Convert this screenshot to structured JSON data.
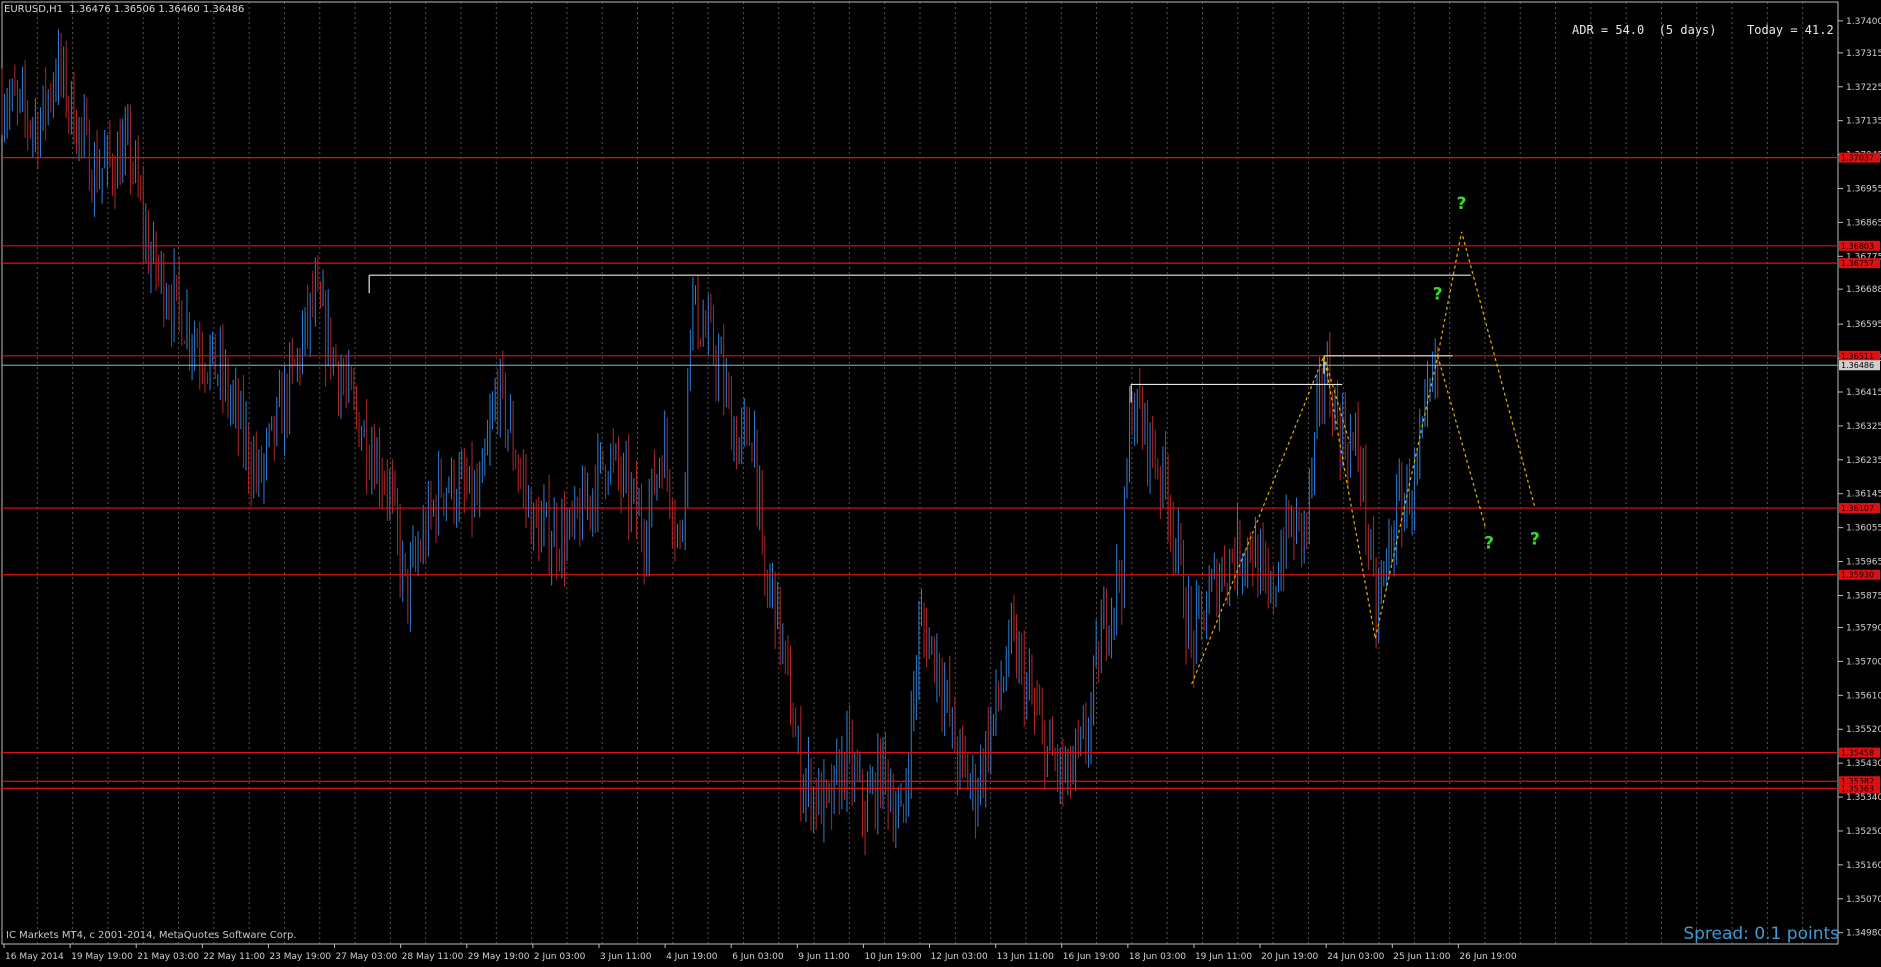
{
  "header": {
    "symbol_info": "EURUSD,H1  1.36476 1.36506 1.36460 1.36486",
    "adr_text": "ADR = 54.0  (5 days)",
    "today_text": "Today = 41.2"
  },
  "footer": {
    "copyright": "IC Markets MT4, c 2001-2014, MetaQuotes Software Corp.",
    "spread": "Spread: 0.1 points"
  },
  "colors": {
    "background": "#000000",
    "grid": "#9a9a9a",
    "bull": "#2f7fd6",
    "bear": "#b22828",
    "level": "#e01010",
    "structure": "#e8e8e8",
    "projection": "#e6b400",
    "question": "#33dd33"
  },
  "chart_data": {
    "type": "candlestick",
    "symbol": "EURUSD",
    "timeframe": "H1",
    "ylim": [
      1.3495,
      1.3745
    ],
    "price_ticks": [
      "1.37400",
      "1.37315",
      "1.37225",
      "1.37135",
      "1.37045",
      "1.36955",
      "1.36865",
      "1.36775",
      "1.36688",
      "1.36595",
      "1.36505",
      "1.36415",
      "1.36325",
      "1.36235",
      "1.36145",
      "1.36055",
      "1.35965",
      "1.35875",
      "1.35790",
      "1.35700",
      "1.35610",
      "1.35520",
      "1.35430",
      "1.35340",
      "1.35250",
      "1.35160",
      "1.35070",
      "1.34980"
    ],
    "time_labels": [
      "16 May 2014",
      "19 May 19:00",
      "21 May 03:00",
      "22 May 11:00",
      "23 May 19:00",
      "27 May 03:00",
      "28 May 11:00",
      "29 May 19:00",
      "2 Jun 03:00",
      "3 Jun 11:00",
      "4 Jun 19:00",
      "6 Jun 03:00",
      "9 Jun 11:00",
      "10 Jun 19:00",
      "12 Jun 03:00",
      "13 Jun 11:00",
      "16 Jun 19:00",
      "18 Jun 03:00",
      "19 Jun 11:00",
      "20 Jun 19:00",
      "24 Jun 03:00",
      "25 Jun 11:00",
      "26 Jun 19:00"
    ],
    "current_price": "1.36486",
    "levels": [
      {
        "price": 1.37037,
        "label": "1.37037"
      },
      {
        "price": 1.36803,
        "label": "1.36803"
      },
      {
        "price": 1.36757,
        "label": "1.36757"
      },
      {
        "price": 1.36511,
        "label": "1.36511"
      },
      {
        "price": 1.36107,
        "label": "1.36107"
      },
      {
        "price": 1.3593,
        "label": "1.35930"
      },
      {
        "price": 1.35458,
        "label": "1.35458"
      },
      {
        "price": 1.35382,
        "label": "1.35382"
      },
      {
        "price": 1.35363,
        "label": "1.35363"
      }
    ],
    "structure_lines": [
      {
        "from": [
          0.2,
          1.36725
        ],
        "to": [
          0.8,
          1.36725
        ]
      },
      {
        "from": [
          0.615,
          1.36435
        ],
        "to": [
          0.73,
          1.36435
        ]
      },
      {
        "from": [
          0.72,
          1.36511
        ],
        "to": [
          0.79,
          1.36511
        ]
      }
    ],
    "projection_paths": [
      [
        [
          0.648,
          1.3564
        ],
        [
          0.72,
          1.36511
        ],
        [
          0.748,
          1.3576
        ],
        [
          0.782,
          1.36511
        ],
        [
          0.795,
          1.3684
        ],
        [
          0.835,
          1.36107
        ]
      ],
      [
        [
          0.72,
          1.36511
        ],
        [
          0.734,
          1.3628
        ]
      ],
      [
        [
          0.782,
          1.36511
        ],
        [
          0.808,
          1.36055
        ]
      ]
    ],
    "question_marks": [
      {
        "t": 0.795,
        "price": 1.369,
        "text": "?"
      },
      {
        "t": 0.782,
        "price": 1.3666,
        "text": "?"
      },
      {
        "t": 0.81,
        "price": 1.36,
        "text": "?"
      },
      {
        "t": 0.835,
        "price": 1.3601,
        "text": "?"
      }
    ],
    "price_path": [
      [
        0.0,
        1.372
      ],
      [
        0.02,
        1.3712
      ],
      [
        0.03,
        1.3728
      ],
      [
        0.05,
        1.37
      ],
      [
        0.07,
        1.3705
      ],
      [
        0.08,
        1.3678
      ],
      [
        0.1,
        1.366
      ],
      [
        0.12,
        1.3645
      ],
      [
        0.14,
        1.3618
      ],
      [
        0.16,
        1.3648
      ],
      [
        0.17,
        1.3666
      ],
      [
        0.19,
        1.3638
      ],
      [
        0.21,
        1.3618
      ],
      [
        0.22,
        1.3588
      ],
      [
        0.24,
        1.3618
      ],
      [
        0.26,
        1.3612
      ],
      [
        0.27,
        1.3643
      ],
      [
        0.29,
        1.3605
      ],
      [
        0.31,
        1.3603
      ],
      [
        0.33,
        1.3625
      ],
      [
        0.35,
        1.3605
      ],
      [
        0.36,
        1.3628
      ],
      [
        0.37,
        1.3598
      ],
      [
        0.375,
        1.3665
      ],
      [
        0.39,
        1.365
      ],
      [
        0.4,
        1.3628
      ],
      [
        0.41,
        1.363
      ],
      [
        0.415,
        1.3588
      ],
      [
        0.42,
        1.359
      ],
      [
        0.435,
        1.354
      ],
      [
        0.45,
        1.353
      ],
      [
        0.46,
        1.3545
      ],
      [
        0.47,
        1.353
      ],
      [
        0.48,
        1.3542
      ],
      [
        0.49,
        1.3525
      ],
      [
        0.5,
        1.358
      ],
      [
        0.51,
        1.357
      ],
      [
        0.52,
        1.3545
      ],
      [
        0.53,
        1.3535
      ],
      [
        0.54,
        1.3555
      ],
      [
        0.55,
        1.3575
      ],
      [
        0.56,
        1.356
      ],
      [
        0.57,
        1.3545
      ],
      [
        0.58,
        1.3538
      ],
      [
        0.59,
        1.3548
      ],
      [
        0.6,
        1.358
      ],
      [
        0.61,
        1.3595
      ],
      [
        0.615,
        1.364
      ],
      [
        0.625,
        1.3628
      ],
      [
        0.635,
        1.3615
      ],
      [
        0.648,
        1.3574
      ],
      [
        0.66,
        1.359
      ],
      [
        0.67,
        1.3598
      ],
      [
        0.68,
        1.3602
      ],
      [
        0.69,
        1.3585
      ],
      [
        0.7,
        1.3605
      ],
      [
        0.71,
        1.3605
      ],
      [
        0.72,
        1.3648
      ],
      [
        0.73,
        1.363
      ],
      [
        0.74,
        1.3624
      ],
      [
        0.748,
        1.3582
      ],
      [
        0.76,
        1.361
      ],
      [
        0.77,
        1.3618
      ],
      [
        0.78,
        1.3645
      ]
    ]
  }
}
